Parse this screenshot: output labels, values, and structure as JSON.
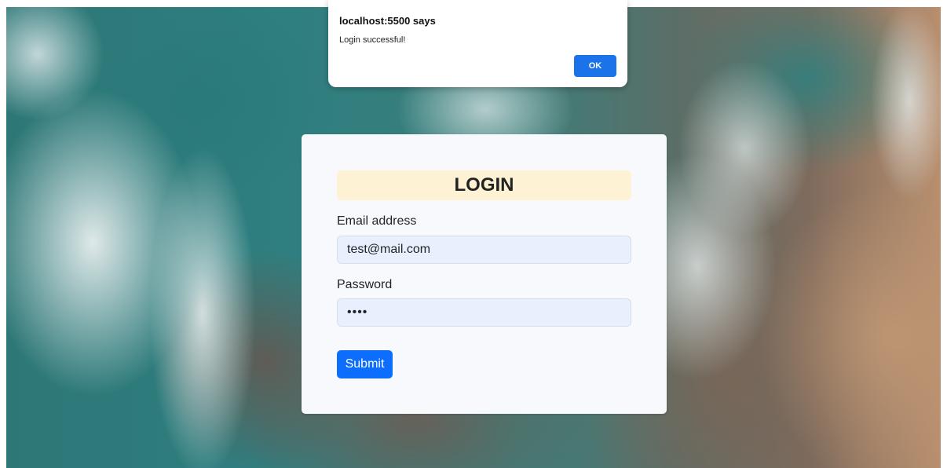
{
  "alert": {
    "title": "localhost:5500 says",
    "message": "Login successful!",
    "ok_label": "OK"
  },
  "login": {
    "heading": "LOGIN",
    "email_label": "Email address",
    "email_value": "test@mail.com",
    "password_label": "Password",
    "password_value": "test",
    "submit_label": "Submit"
  },
  "colors": {
    "primary_button": "#0d6efd",
    "heading_background": "#fdf2d4",
    "input_background": "#e8f0fe",
    "card_background": "#f8f9fc"
  }
}
